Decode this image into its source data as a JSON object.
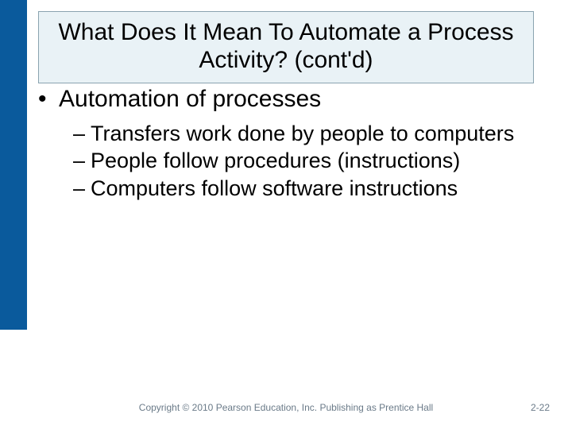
{
  "title": "What Does It Mean To Automate a Process Activity? (cont'd)",
  "bullets": {
    "main": "Automation of processes",
    "subs": [
      "Transfers work done by people to computers",
      "People follow procedures (instructions)",
      "Computers follow software instructions"
    ]
  },
  "footer": {
    "copyright": "Copyright © 2010 Pearson Education, Inc. Publishing as Prentice Hall",
    "page": "2-22"
  },
  "colors": {
    "band": "#0a5a9c",
    "titleBg": "#e9f2f6"
  }
}
